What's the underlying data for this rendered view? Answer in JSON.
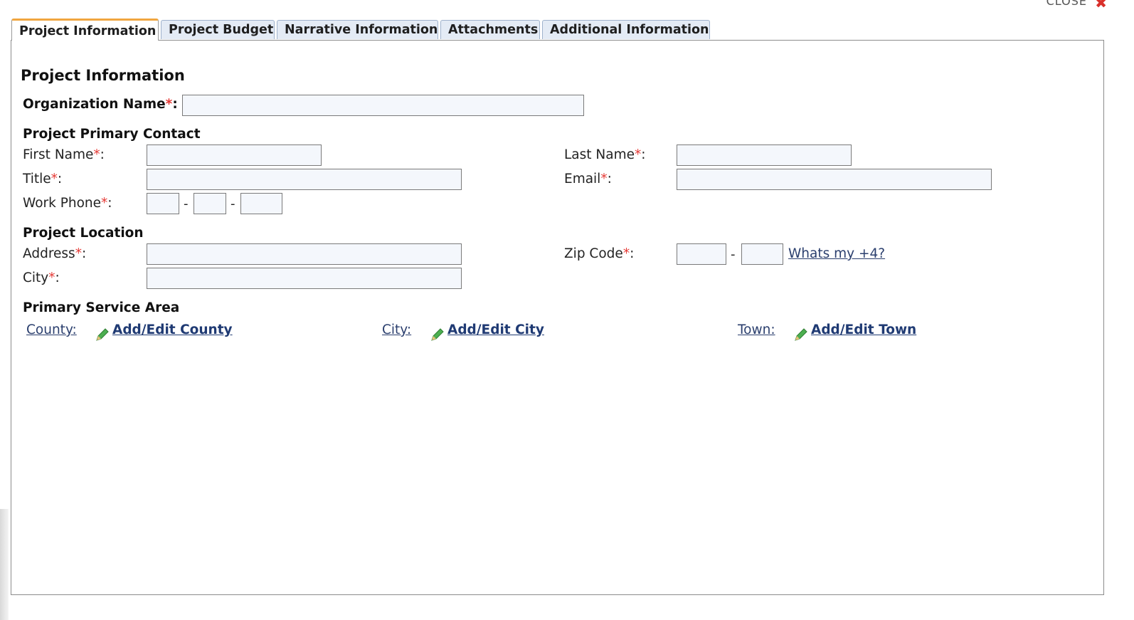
{
  "window": {
    "close_label": "CLOSE",
    "close_icon": "close-x-icon",
    "close_color": "#d9302b"
  },
  "tabs": [
    {
      "label": "Project Information",
      "active": true
    },
    {
      "label": "Project Budget",
      "active": false
    },
    {
      "label": "Narrative Information",
      "active": false
    },
    {
      "label": "Attachments",
      "active": false
    },
    {
      "label": "Additional Information",
      "active": false
    }
  ],
  "colors": {
    "accent_tab": "#f0a640",
    "required_marker": "#e53935",
    "link": "#1f3a73",
    "pencil_icon": "#4caf50"
  },
  "page": {
    "title": "Project Information"
  },
  "org": {
    "label": "Organization Name",
    "required_mark": "*",
    "suffix": ":",
    "value": ""
  },
  "contact": {
    "heading": "Project Primary Contact",
    "first_name": {
      "label": "First Name",
      "required_mark": "*",
      "suffix": ":",
      "value": ""
    },
    "last_name": {
      "label": "Last Name",
      "required_mark": "*",
      "suffix": ":",
      "value": ""
    },
    "title": {
      "label": "Title",
      "required_mark": "*",
      "suffix": ":",
      "value": ""
    },
    "email": {
      "label": "Email",
      "required_mark": "*",
      "suffix": ":",
      "value": ""
    },
    "work_phone": {
      "label": "Work Phone",
      "required_mark": "*",
      "suffix": ":",
      "separator": "-",
      "area": "",
      "prefix": "",
      "line": ""
    }
  },
  "location": {
    "heading": "Project Location",
    "address": {
      "label": "Address",
      "required_mark": "*",
      "suffix": ":",
      "value": ""
    },
    "city": {
      "label": "City",
      "required_mark": "*",
      "suffix": ":",
      "value": ""
    },
    "zip": {
      "label": "Zip Code",
      "required_mark": "*",
      "suffix": ":",
      "separator": "-",
      "zip5": "",
      "zip4": "",
      "help_link": "Whats my +4?"
    }
  },
  "service_area": {
    "heading": "Primary Service Area",
    "county": {
      "label": "County:",
      "action": "Add/Edit County",
      "icon": "pencil-icon"
    },
    "city": {
      "label": "City:",
      "action": "Add/Edit City",
      "icon": "pencil-icon"
    },
    "town": {
      "label": "Town:",
      "action": "Add/Edit Town",
      "icon": "pencil-icon"
    }
  }
}
